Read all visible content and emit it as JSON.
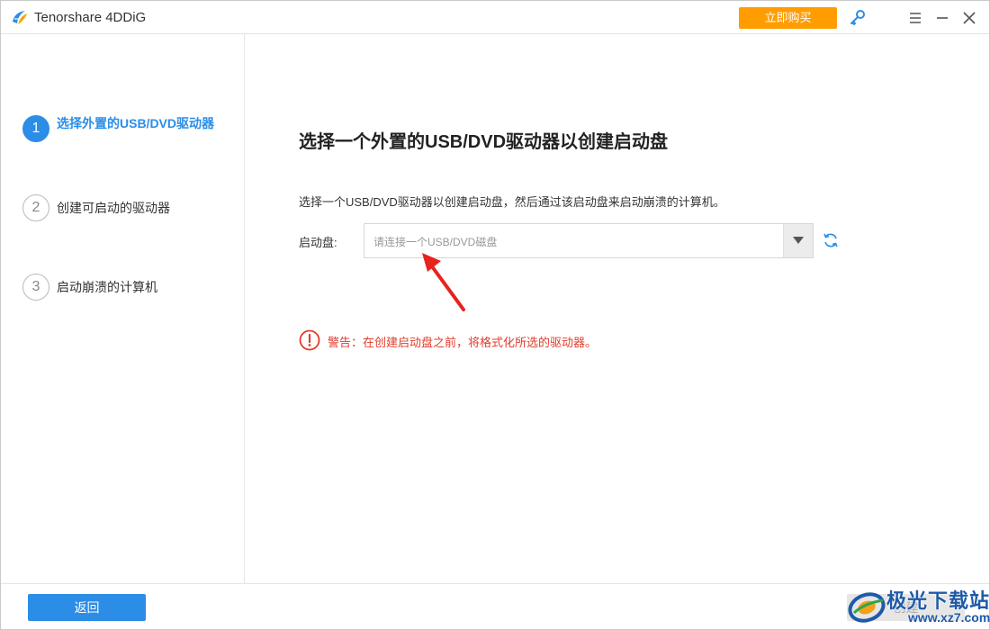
{
  "app": {
    "title": "Tenorshare 4DDiG",
    "buy_label": "立即购买"
  },
  "sidebar": {
    "steps": [
      {
        "number": "1",
        "label": "选择外置的USB/DVD驱动器",
        "active": true
      },
      {
        "number": "2",
        "label": "创建可启动的驱动器",
        "active": false
      },
      {
        "number": "3",
        "label": "启动崩溃的计算机",
        "active": false
      }
    ]
  },
  "main": {
    "title": "选择一个外置的USB/DVD驱动器以创建启动盘",
    "description": "选择一个USB/DVD驱动器以创建启动盘，然后通过该启动盘来启动崩溃的计算机。",
    "drive_label": "启动盘:",
    "drive_placeholder": "请连接一个USB/DVD磁盘",
    "warning": "警告：在创建启动盘之前，将格式化所选的驱动器。"
  },
  "footer": {
    "back_label": "返回",
    "create_label": "创建"
  },
  "watermark": {
    "name": "极光下载站",
    "url": "www.xz7.com"
  },
  "colors": {
    "accent": "#2b8de6",
    "buy": "#ff9d00",
    "warning": "#e23c2c",
    "annotation_arrow": "#e8221c"
  },
  "icons": {
    "logo": "app-logo-icon",
    "key": "key-icon",
    "menu": "hamburger-menu-icon",
    "minimize": "minimize-icon",
    "close": "close-icon",
    "refresh": "refresh-icon",
    "dropdown": "caret-down-icon",
    "warning": "exclamation-circle-icon"
  }
}
